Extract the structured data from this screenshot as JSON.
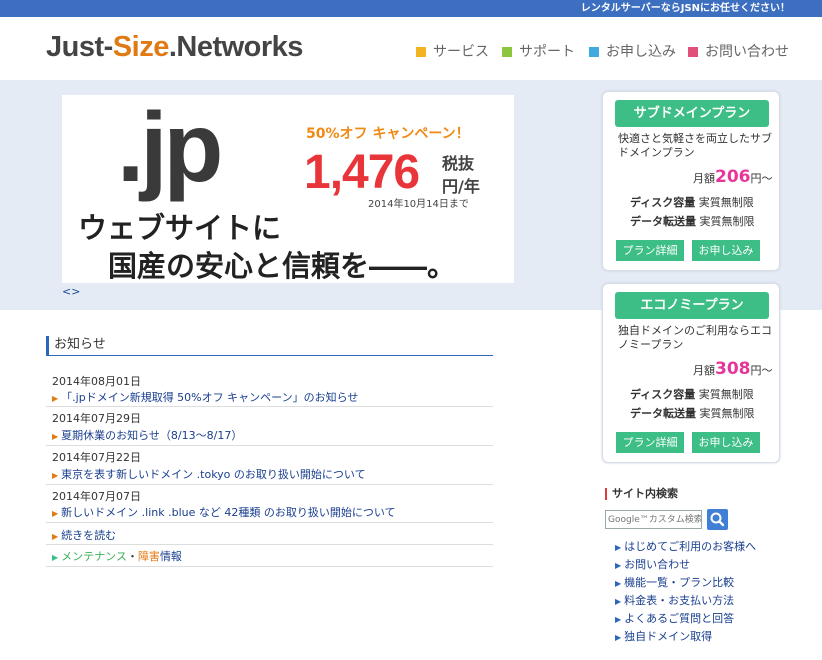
{
  "topbar": {
    "text": "レンタルサーバーならJSNにお任せください！"
  },
  "header": {
    "logo": {
      "part1": "Just-",
      "part2": "Size",
      "part3": ".Networks"
    },
    "nav": [
      {
        "label": "サービス",
        "color": "#f4b323"
      },
      {
        "label": "サポート",
        "color": "#8cc63f"
      },
      {
        "label": "お申し込み",
        "color": "#3fa9e0"
      },
      {
        "label": "お問い合わせ",
        "color": "#e0507a"
      }
    ]
  },
  "banner": {
    "tld": ".jp",
    "campaign": "50%オフ キャンペーン！",
    "price": "1,476",
    "tax": "税抜",
    "unit": "円/年",
    "until": "2014年10月14日まで",
    "line1": "ウェブサイトに",
    "line2": "国産の安心と信頼を――。",
    "slider_nav": "<>"
  },
  "plans": [
    {
      "title": "サブドメインプラン",
      "desc": "快適さと気軽さを両立したサブドメインプラン",
      "price_prefix": "月額",
      "price": "206",
      "price_suffix": "円〜",
      "disk_label": "ディスク容量",
      "disk_value": "実質無制限",
      "transfer_label": "データ転送量",
      "transfer_value": "実質無制限",
      "detail_button": "プラン詳細",
      "apply_button": "お申し込み"
    },
    {
      "title": "エコノミープラン",
      "desc": "独自ドメインのご利用ならエコノミープラン",
      "price_prefix": "月額",
      "price": "308",
      "price_suffix": "円〜",
      "disk_label": "ディスク容量",
      "disk_value": "実質無制限",
      "transfer_label": "データ転送量",
      "transfer_value": "実質無制限",
      "detail_button": "プラン詳細",
      "apply_button": "お申し込み"
    }
  ],
  "news": {
    "heading": "お知らせ",
    "items": [
      {
        "date": "2014年08月01日",
        "title": "「.jpドメイン新規取得 50%オフ キャンペーン」のお知らせ"
      },
      {
        "date": "2014年07月29日",
        "title": "夏期休業のお知らせ（8/13〜8/17）"
      },
      {
        "date": "2014年07月22日",
        "title": "東京を表す新しいドメイン .tokyo のお取り扱い開始について"
      },
      {
        "date": "2014年07月07日",
        "title": "新しいドメイン .link .blue など 42種類 のお取り扱い開始について"
      }
    ],
    "more": "続きを読む",
    "maintenance_a": "メンテナンス",
    "maintenance_sep": "・",
    "maintenance_b": "障害",
    "maintenance_c": "情報"
  },
  "search": {
    "heading": "サイト内検索",
    "placeholder": "Google™カスタム検索"
  },
  "side_links": [
    "はじめてご利用のお客様へ",
    "お問い合わせ",
    "機能一覧・プラン比較",
    "料金表・お支払い方法",
    "よくあるご質問と回答",
    "独自ドメイン取得"
  ]
}
